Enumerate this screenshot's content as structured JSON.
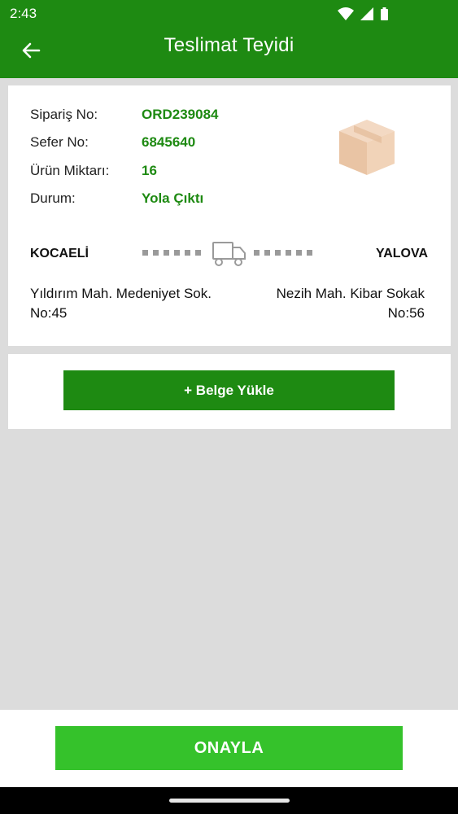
{
  "status_bar": {
    "time": "2:43",
    "icons": [
      "wifi-icon",
      "signal-icon",
      "battery-icon"
    ]
  },
  "app_bar": {
    "title": "Teslimat Teyidi",
    "back_icon": "arrow-left-icon"
  },
  "order": {
    "rows": [
      {
        "label": "Sipariş No:",
        "value": "ORD239084"
      },
      {
        "label": "Sefer No:",
        "value": "6845640"
      },
      {
        "label": "Ürün Miktarı:",
        "value": "16"
      },
      {
        "label": "Durum:",
        "value": "Yola Çıktı"
      }
    ],
    "illustration": "package-box-icon"
  },
  "route": {
    "from_city": "KOCAELİ",
    "to_city": "YALOVA",
    "from_address": "Yıldırım Mah. Medeniyet Sok. No:45",
    "to_address": "Nezih Mah. Kibar Sokak No:56",
    "icon": "truck-icon"
  },
  "upload": {
    "label": "+ Belge Yükle"
  },
  "confirm": {
    "label": "ONAYLA"
  },
  "colors": {
    "primary": "#1e8a12",
    "accent": "#35c22b",
    "background": "#dcdcdc"
  }
}
